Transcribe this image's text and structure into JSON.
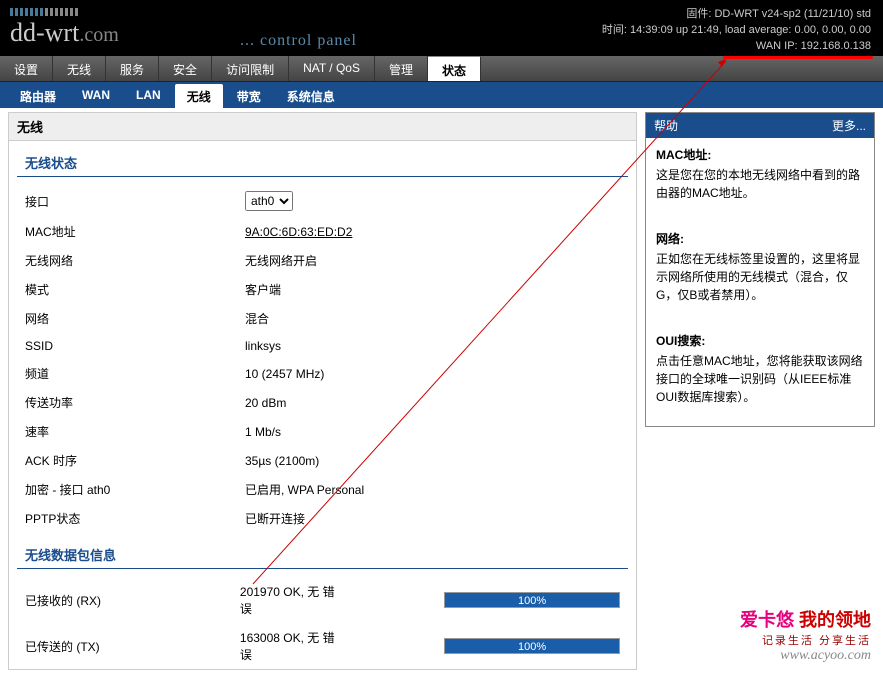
{
  "header": {
    "logo": "dd-wrt",
    "logo_suffix": ".com",
    "subtitle": "... control panel",
    "firmware_label": "固件: DD-WRT v24-sp2 (11/21/10) std",
    "time_label": "时间: 14:39:09 up 21:49, load average: 0.00, 0.00, 0.00",
    "wan_label": "WAN IP: 192.168.0.138"
  },
  "main_tabs": [
    "设置",
    "无线",
    "服务",
    "安全",
    "访问限制",
    "NAT / QoS",
    "管理",
    "状态"
  ],
  "main_tab_active": 7,
  "sub_tabs": [
    "路由器",
    "WAN",
    "LAN",
    "无线",
    "带宽",
    "系统信息"
  ],
  "sub_tab_active": 3,
  "panel_title": "无线",
  "status_section": {
    "title": "无线状态",
    "rows": [
      {
        "label": "接口",
        "type": "select",
        "value": "ath0"
      },
      {
        "label": "MAC地址",
        "type": "link",
        "value": "9A:0C:6D:63:ED:D2"
      },
      {
        "label": "无线网络",
        "value": "无线网络开启"
      },
      {
        "label": "模式",
        "value": "客户端"
      },
      {
        "label": "网络",
        "value": "混合"
      },
      {
        "label": "SSID",
        "value": "linksys"
      },
      {
        "label": "频道",
        "value": "10 (2457 MHz)"
      },
      {
        "label": "传送功率",
        "value": "20 dBm"
      },
      {
        "label": "速率",
        "value": "1 Mb/s"
      },
      {
        "label": "ACK 时序",
        "value": "35µs (2100m)"
      },
      {
        "label": "加密 - 接口 ath0",
        "value": "已启用, WPA Personal"
      },
      {
        "label": "PPTP状态",
        "value": "已断开连接"
      }
    ]
  },
  "packet_section": {
    "title": "无线数据包信息",
    "rows": [
      {
        "label": "已接收的 (RX)",
        "value": "201970 OK, 无 错误",
        "pct": "100%"
      },
      {
        "label": "已传送的 (TX)",
        "value": "163008 OK, 无 错误",
        "pct": "100%"
      }
    ]
  },
  "help": {
    "title": "帮助",
    "more": "更多...",
    "items": [
      {
        "term": "MAC地址:",
        "desc": "这是您在您的本地无线网络中看到的路由器的MAC地址。"
      },
      {
        "term": "网络:",
        "desc": "正如您在无线标签里设置的，这里将显示网络所使用的无线模式（混合，仅G，仅B或者禁用）。"
      },
      {
        "term": "OUI搜索:",
        "desc": "点击任意MAC地址，您将能获取该网络接口的全球唯一识别码（从IEEE标准OUI数据库搜索）。"
      }
    ]
  },
  "watermark": {
    "cn1": "爱卡悠 ",
    "cn2": "我的领地",
    "sub": "记录生活 分享生活",
    "url": "www.acyoo.com"
  }
}
